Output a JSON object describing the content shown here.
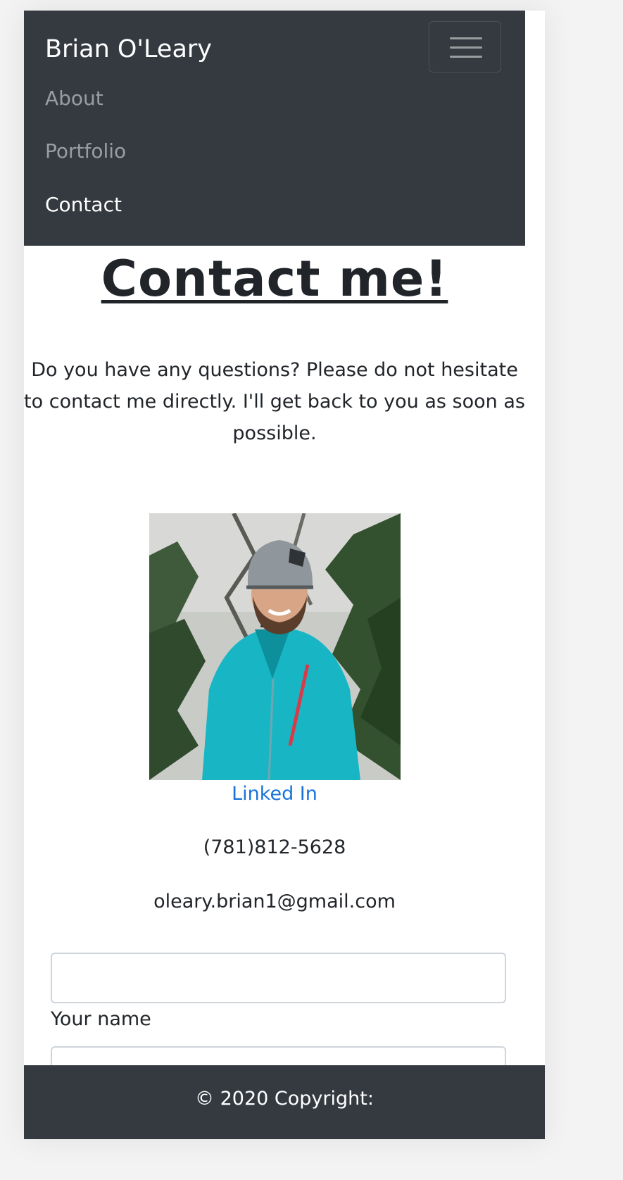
{
  "navbar": {
    "brand": "Brian O'Leary",
    "items": [
      {
        "label": "About",
        "active": false
      },
      {
        "label": "Portfolio",
        "active": false
      },
      {
        "label": "Contact",
        "active": true
      }
    ],
    "toggler_icon": "hamburger-icon",
    "background_color": "#343a40"
  },
  "main": {
    "heading": "Contact me!",
    "intro": "Do you have any questions? Please do not hesitate to contact me directly. I'll get back to you as soon as possible.",
    "photo_description": "portrait photo",
    "linkedin_label": "Linked In",
    "phone": "(781)812-5628",
    "email": "oleary.brian1@gmail.com",
    "form": {
      "name_value": "",
      "name_label": "Your name",
      "email_value": ""
    }
  },
  "footer": {
    "copyright": "© 2020 Copyright:"
  },
  "colors": {
    "link": "#1a73d9",
    "text": "#212529"
  }
}
